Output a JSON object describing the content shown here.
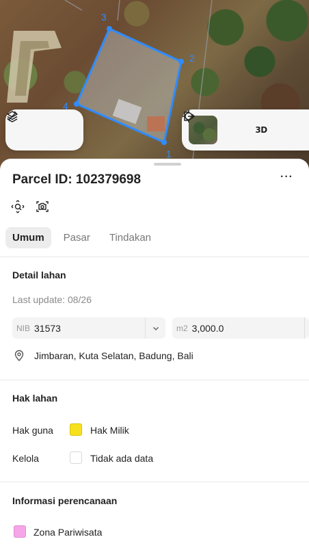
{
  "map": {
    "vertex_labels": [
      "1",
      "2",
      "3",
      "4"
    ],
    "controls_left": [
      {
        "icon": "layers-icon"
      },
      {
        "icon": "measure-icon"
      }
    ],
    "controls_right": {
      "basemap_thumbnail": "satellite",
      "locate_icon": "crosshair-icon",
      "label_3d": "3D",
      "share_icon": "share-icon"
    },
    "parcel_color": "#2f8cff"
  },
  "parcel": {
    "title": "Parcel ID: 102379698",
    "more_label": "···"
  },
  "tools": [
    {
      "icon": "zoom-to-icon"
    },
    {
      "icon": "camera-icon"
    }
  ],
  "tabs": [
    {
      "label": "Umum",
      "active": true
    },
    {
      "label": "Pasar",
      "active": false
    },
    {
      "label": "Tindakan",
      "active": false
    }
  ],
  "detail": {
    "section_title": "Detail lahan",
    "last_update": "Last update: 08/26",
    "nib_label": "NIB",
    "nib_value": "31573",
    "area_label": "m2",
    "area_value": "3,000.0",
    "location": "Jimbaran, Kuta Selatan, Badung, Bali"
  },
  "rights": {
    "section_title": "Hak lahan",
    "rows": [
      {
        "label": "Hak guna",
        "value": "Hak Milik",
        "color": "#f7e11e"
      },
      {
        "label": "Kelola",
        "value": "Tidak ada data",
        "color": "#ffffff"
      }
    ]
  },
  "planning": {
    "section_title": "Informasi perencanaan",
    "zone": "Zona Pariwisata",
    "zone_color": "#f6a6e8"
  }
}
